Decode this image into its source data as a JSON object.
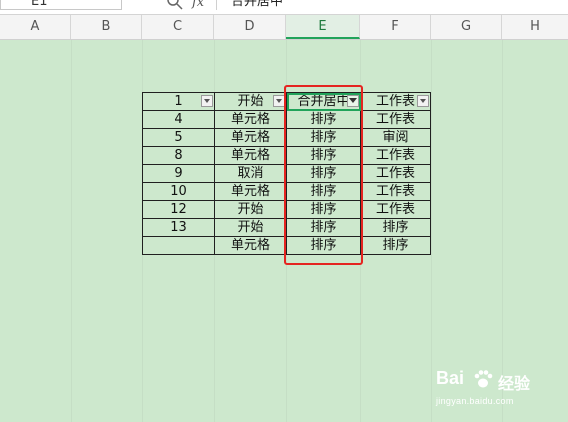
{
  "formula_bar": {
    "name_box": "E1",
    "fx_label": "fx",
    "formula": "合并居中"
  },
  "columns": [
    "A",
    "B",
    "C",
    "D",
    "E",
    "F",
    "G",
    "H"
  ],
  "active_column": "E",
  "table": {
    "header": [
      "1",
      "开始",
      "合并居中",
      "工作表"
    ],
    "rows": [
      [
        "4",
        "单元格",
        "排序",
        "工作表"
      ],
      [
        "5",
        "单元格",
        "排序",
        "审阅"
      ],
      [
        "8",
        "单元格",
        "排序",
        "工作表"
      ],
      [
        "9",
        "取消",
        "排序",
        "工作表"
      ],
      [
        "10",
        "单元格",
        "排序",
        "工作表"
      ],
      [
        "12",
        "开始",
        "排序",
        "工作表"
      ],
      [
        "13",
        "开始",
        "排序",
        "排序"
      ],
      [
        "",
        "单元格",
        "排序",
        "排序"
      ]
    ]
  },
  "watermark": {
    "brand": "Bai",
    "text": "经验",
    "url": "jingyan.baidu.com"
  },
  "colors": {
    "sheet_background": "#cde8cd",
    "highlight_border": "#e52420",
    "selection": "#21a35a"
  }
}
